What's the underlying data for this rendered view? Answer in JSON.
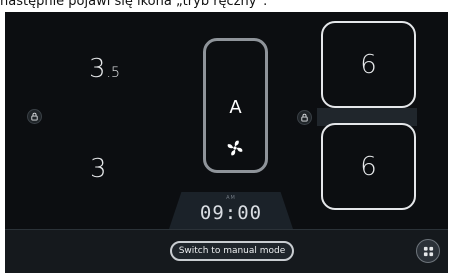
{
  "caption": "następnie pojawi się ikona „tryb ręczny”.",
  "zones": {
    "left_top_value": "3",
    "left_top_subscript": ".5",
    "left_bottom_value": "3",
    "right_top_value": "6",
    "right_bottom_value": "6"
  },
  "center": {
    "mode_letter": "A",
    "fan_icon": "fan-icon"
  },
  "timer": {
    "period": "AM",
    "time": "09:00"
  },
  "bottom_bar": {
    "manual_mode_label": "Switch to manual mode",
    "menu_icon": "grid-menu-icon"
  },
  "icons": {
    "lock": "lock-icon"
  },
  "colors": {
    "background": "#0c0e11",
    "box_border": "#e5e7ea",
    "center_border": "#8f949a",
    "timer_bg": "#1b2229"
  }
}
